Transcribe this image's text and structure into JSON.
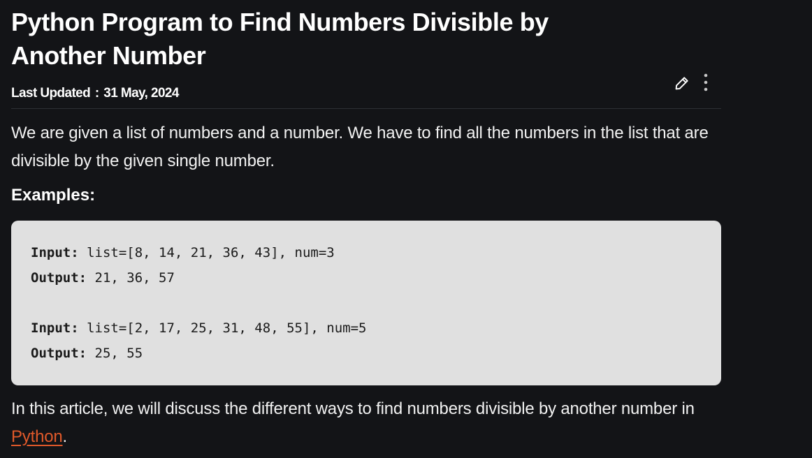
{
  "article": {
    "title": "Python Program to Find Numbers Divisible by Another Number",
    "last_updated_label": "Last Updated",
    "last_updated_date": "31 May, 2024",
    "intro": "We are given a list of numbers and a number. We have to find all the numbers in the list that are divisible by the given single number.",
    "examples_heading": "Examples:",
    "examples": [
      {
        "input_label": "Input:",
        "input_value": "list=[8, 14, 21, 36, 43], num=3",
        "output_label": "Output:",
        "output_value": "21, 36, 57"
      },
      {
        "input_label": "Input:",
        "input_value": "list=[2, 17, 25, 31, 48, 55], num=5",
        "output_label": "Output:",
        "output_value": "25, 55"
      }
    ],
    "outro_text": "In this article, we will discuss the different ways to find numbers divisible by another number in ",
    "outro_link": "Python",
    "outro_end": "."
  },
  "toolbar": {
    "edit_icon": "pencil-icon",
    "more_icon": "more-vertical-icon"
  },
  "colors": {
    "background": "#131417",
    "code_background": "#e0e0e0",
    "link": "#e0592a"
  }
}
